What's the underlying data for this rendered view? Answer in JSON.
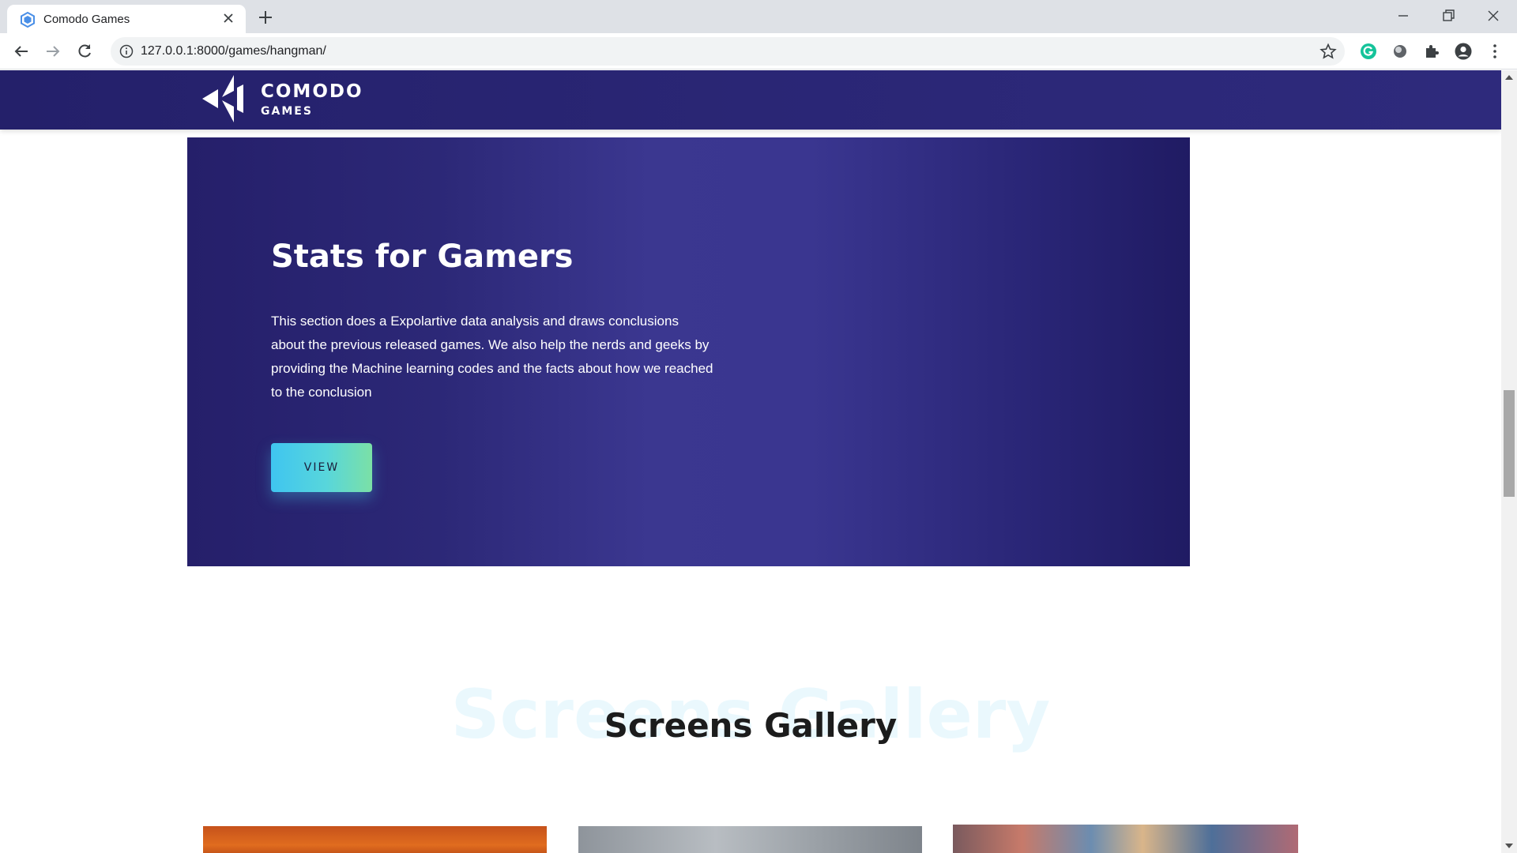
{
  "browser": {
    "tab_title": "Comodo Games",
    "url": "127.0.0.1:8000/games/hangman/",
    "icons": [
      "tab-favicon-icon",
      "close-icon",
      "plus-icon",
      "minimize-icon",
      "restore-icon",
      "window-close-icon",
      "back-arrow-icon",
      "forward-arrow-icon",
      "reload-icon",
      "info-icon",
      "star-icon",
      "grammarly-icon",
      "extension-circle-icon",
      "puzzle-icon",
      "profile-icon",
      "kebab-menu-icon"
    ]
  },
  "site": {
    "logo_word1": "COMODO",
    "logo_word2": "GAMES"
  },
  "hero": {
    "title": "Stats for Gamers",
    "text": "This section does a Expolartive data analysis and draws conclusions about the previous released games. We also help the nerds and geeks by providing the Machine learning codes and the facts about how we reached to the conclusion",
    "button_label": "VIEW"
  },
  "gallery": {
    "background_title": "Screens Gallery",
    "title": "Screens Gallery"
  },
  "colors": {
    "header": "#2a2675",
    "hero_dark": "#251f6a",
    "hero_light": "#3b3790",
    "button_start": "#3fc5f0",
    "button_end": "#7be0a6"
  }
}
